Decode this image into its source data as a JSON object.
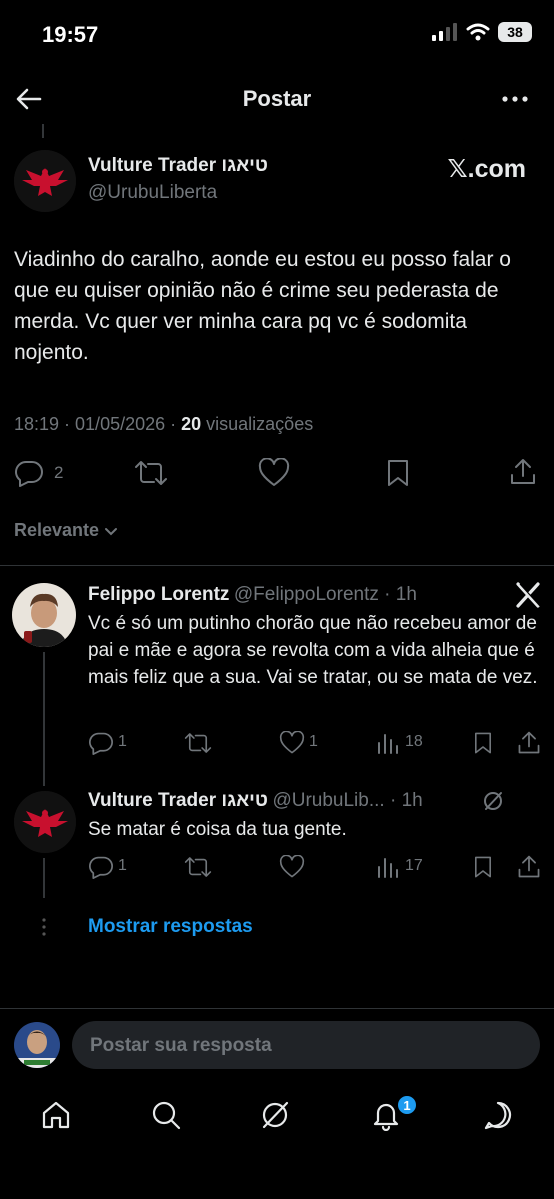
{
  "status_bar": {
    "time": "19:57",
    "battery": "38"
  },
  "header": {
    "title": "Postar"
  },
  "post": {
    "author_name": "Vulture Trader טיאגו",
    "author_handle": "@UrubuLiberta",
    "source_badge": "𝕏.com",
    "text": "Viadinho do caralho, aonde eu estou eu posso falar o que eu quiser opinião não é crime seu pederasta de merda. Vc quer ver minha cara pq vc é sodomita nojento.",
    "time": "18:19 · 01/05/2026 · ",
    "views_count": "20",
    "views_label": " visualizações",
    "reply_count": "2"
  },
  "sort": {
    "label": "Relevante"
  },
  "replies": [
    {
      "author_name": "Felippo Lorentz",
      "author_handle": "@FelippoLorentz · 1h",
      "text": "Vc é só um putinho chorão que não recebeu amor de pai e mãe e agora se revolta com a vida alheia que é mais feliz que a sua. Vai se tratar, ou se mata de vez.",
      "reply_count": "1",
      "like_count": "1",
      "view_count": "18"
    },
    {
      "author_name": "Vulture Trader טיאגו",
      "author_handle": "@UrubuLib... · 1h",
      "text": "Se matar é coisa da tua gente.",
      "reply_count": "1",
      "view_count": "17"
    }
  ],
  "show_replies": "Mostrar respostas",
  "compose": {
    "placeholder": "Postar sua resposta"
  },
  "bottom_nav": {
    "notifications_badge": "1"
  },
  "icons": [
    "back-arrow-icon",
    "more-icon",
    "x-logo-icon",
    "reply-icon",
    "retweet-icon",
    "like-icon",
    "bookmark-icon",
    "share-icon",
    "views-icon",
    "grok-icon",
    "home-icon",
    "search-icon",
    "bell-icon",
    "messages-icon"
  ],
  "colors": {
    "background": "#000000",
    "text": "#e7e9ea",
    "muted": "#71767b",
    "accent": "#1d9bf0",
    "eagle": "#c8102e"
  }
}
